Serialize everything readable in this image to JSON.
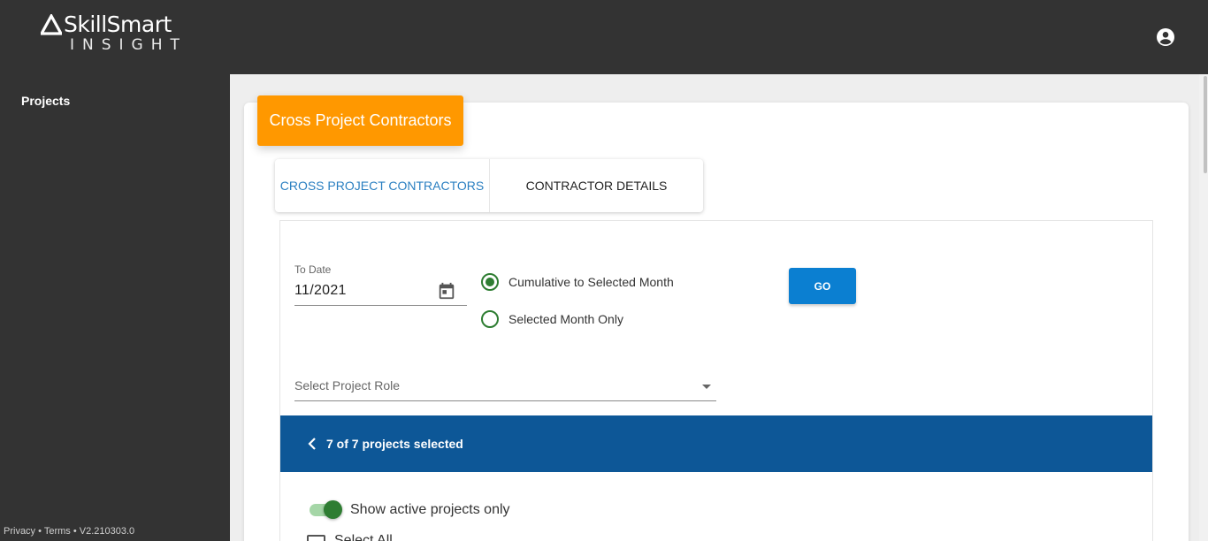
{
  "brand": {
    "name": "SkillSmart",
    "sub": "INSIGHT"
  },
  "header": {
    "account_icon": "account-circle-icon"
  },
  "sidebar": {
    "items": [
      {
        "label": "Projects"
      }
    ]
  },
  "footer": {
    "privacy": "Privacy",
    "sep1": " • ",
    "terms": "Terms",
    "sep2": " • ",
    "version": "V2.210303.0"
  },
  "card": {
    "title": "Cross Project Contractors"
  },
  "tabs": [
    {
      "label": "CROSS PROJECT CONTRACTORS",
      "active": true
    },
    {
      "label": "CONTRACTOR DETAILS",
      "active": false
    }
  ],
  "filters": {
    "to_date_label": "To Date",
    "to_date_value": "11/2021",
    "calendar_icon": "calendar-icon",
    "options": [
      {
        "label": "Cumulative to Selected Month",
        "selected": true
      },
      {
        "label": "Selected Month Only",
        "selected": false
      }
    ],
    "go_label": "GO",
    "role_placeholder": "Select Project Role"
  },
  "projects": {
    "summary": "7 of 7 projects selected",
    "show_active_label": "Show active projects only",
    "show_active_on": true,
    "select_all_label": "Select All",
    "select_all_checked": false
  },
  "colors": {
    "topbar": "#333333",
    "accent_orange": "#ff9800",
    "tab_active": "#2a7fc1",
    "go_button": "#0b7fd1",
    "projects_bar": "#0d5797",
    "radio_green": "#2e7d32"
  }
}
